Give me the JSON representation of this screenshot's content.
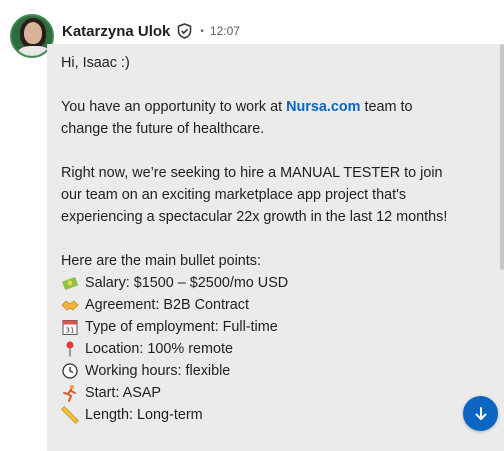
{
  "sender": {
    "name": "Katarzyna Ulok",
    "time": "12:07",
    "verified_icon": "verified-shield-icon"
  },
  "message": {
    "greeting": "Hi, Isaac :)",
    "p1_before": "You have an opportunity to work at ",
    "p1_link": "Nursa.com",
    "p1_after": " team to change the future of healthcare.",
    "p2": "Right now, we’re seeking to hire a MANUAL TESTER to join our team on an exciting marketplace app project that's experiencing a spectacular 22x growth in the last 12 months!",
    "bullets_intro": "Here are the main bullet points:",
    "bullets": [
      {
        "icon": "money-icon",
        "text": "Salary: $1500 – $2500/mo USD"
      },
      {
        "icon": "handshake-icon",
        "text": "Agreement: B2B Contract"
      },
      {
        "icon": "calendar-icon",
        "text": "Type of employment: Full-time"
      },
      {
        "icon": "pin-icon",
        "text": "Location: 100% remote"
      },
      {
        "icon": "clock-icon",
        "text": "Working hours: flexible"
      },
      {
        "icon": "runner-icon",
        "text": "Start: ASAP"
      },
      {
        "icon": "ruler-icon",
        "text": "Length: Long-term"
      }
    ]
  },
  "scroll_button": {
    "icon": "arrow-down-icon"
  },
  "colors": {
    "link": "#0a66c2",
    "bubble": "#ebebeb",
    "fab": "#0a66c2"
  }
}
